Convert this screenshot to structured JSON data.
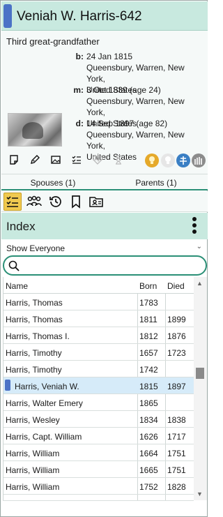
{
  "person": {
    "name": "Veniah W. Harris-642",
    "relationship": "Third great-grandfather",
    "events": [
      {
        "label": "b:",
        "line1": "24 Jan 1815",
        "line2": "Queensbury, Warren, New York,",
        "line3": "United States"
      },
      {
        "label": "m:",
        "line1": "3 Oct 1839 (age 24)",
        "line2": "Queensbury, Warren, New York,",
        "line3": "United States"
      },
      {
        "label": "d:",
        "line1": "14 Sep 1897 (age 82)",
        "line2": "Queensbury, Warren, New York,",
        "line3": "United States"
      }
    ]
  },
  "tabs": {
    "spouses": "Spouses (1)",
    "parents": "Parents (1)"
  },
  "index": {
    "title": "Index",
    "filter": "Show Everyone",
    "search_placeholder": "",
    "columns": {
      "name": "Name",
      "born": "Born",
      "died": "Died"
    },
    "rows": [
      {
        "name": "Harris, Thomas",
        "born": "1783",
        "died": ""
      },
      {
        "name": "Harris, Thomas",
        "born": "1811",
        "died": "1899"
      },
      {
        "name": "Harris, Thomas I.",
        "born": "1812",
        "died": "1876"
      },
      {
        "name": "Harris, Timothy",
        "born": "1657",
        "died": "1723"
      },
      {
        "name": "Harris, Timothy",
        "born": "1742",
        "died": ""
      },
      {
        "name": "Harris, Veniah W.",
        "born": "1815",
        "died": "1897"
      },
      {
        "name": "Harris, Walter Emery",
        "born": "1865",
        "died": ""
      },
      {
        "name": "Harris, Wesley",
        "born": "1834",
        "died": "1838"
      },
      {
        "name": "Harris, Capt. William",
        "born": "1626",
        "died": "1717"
      },
      {
        "name": "Harris, William",
        "born": "1664",
        "died": "1751"
      },
      {
        "name": "Harris, William",
        "born": "1665",
        "died": "1751"
      },
      {
        "name": "Harris, William",
        "born": "1752",
        "died": "1828"
      }
    ]
  },
  "colors": {
    "accent": "#2a8f76",
    "header_bg": "#c8e9df",
    "male": "#4b72c6",
    "selected_row": "#d6ebf9"
  }
}
